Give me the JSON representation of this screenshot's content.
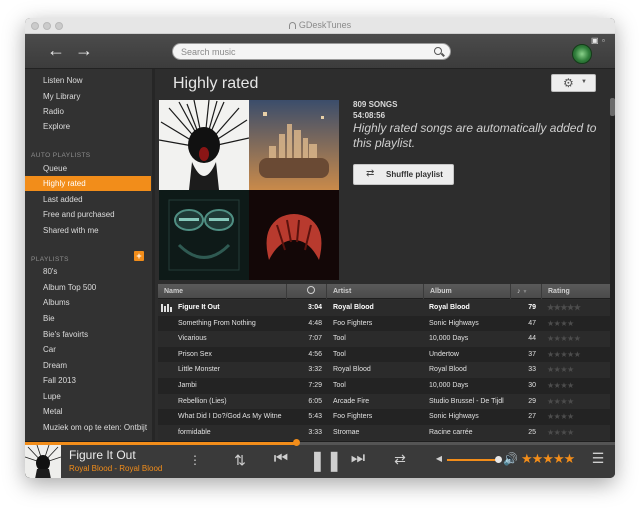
{
  "window": {
    "title": "GDeskTunes"
  },
  "search": {
    "placeholder": "Search music"
  },
  "sidebar": {
    "nav": [
      {
        "label": "Listen Now"
      },
      {
        "label": "My Library"
      },
      {
        "label": "Radio"
      },
      {
        "label": "Explore"
      }
    ],
    "auto_heading": "AUTO PLAYLISTS",
    "auto": [
      {
        "label": "Queue"
      },
      {
        "label": "Highly rated"
      },
      {
        "label": "Last added"
      },
      {
        "label": "Free and purchased"
      },
      {
        "label": "Shared with me"
      }
    ],
    "playlists_heading": "PLAYLISTS",
    "add_label": "+",
    "playlists": [
      {
        "label": "80's"
      },
      {
        "label": "Album Top 500"
      },
      {
        "label": "Albums"
      },
      {
        "label": "Bie"
      },
      {
        "label": "Bie's favoirts"
      },
      {
        "label": "Car"
      },
      {
        "label": "Dream"
      },
      {
        "label": "Fall 2013"
      },
      {
        "label": "Lupe"
      },
      {
        "label": "Metal"
      },
      {
        "label": "Muziek om op te eten: Ontbijt"
      }
    ]
  },
  "main": {
    "title": "Highly rated",
    "song_count": "809 SONGS",
    "duration": "54:08:56",
    "description": "Highly rated songs are automatically added to this playlist.",
    "shuffle_label": "Shuffle playlist",
    "columns": {
      "name": "Name",
      "artist": "Artist",
      "album": "Album",
      "rating": "Rating"
    },
    "rows": [
      {
        "name": "Figure It Out",
        "time": "3:04",
        "artist": "Royal Blood",
        "album": "Royal Blood",
        "plays": "79",
        "stars": "★★★★★"
      },
      {
        "name": "Something From Nothing",
        "time": "4:48",
        "artist": "Foo Fighters",
        "album": "Sonic Highways",
        "plays": "47",
        "stars": "★★★★"
      },
      {
        "name": "Vicarious",
        "time": "7:07",
        "artist": "Tool",
        "album": "10,000 Days",
        "plays": "44",
        "stars": "★★★★★"
      },
      {
        "name": "Prison Sex",
        "time": "4:56",
        "artist": "Tool",
        "album": "Undertow",
        "plays": "37",
        "stars": "★★★★★"
      },
      {
        "name": "Little Monster",
        "time": "3:32",
        "artist": "Royal Blood",
        "album": "Royal Blood",
        "plays": "33",
        "stars": "★★★★"
      },
      {
        "name": "Jambi",
        "time": "7:29",
        "artist": "Tool",
        "album": "10,000 Days",
        "plays": "30",
        "stars": "★★★★"
      },
      {
        "name": "Rebellion (Lies)",
        "time": "6:05",
        "artist": "Arcade Fire",
        "album": "Studio Brussel - De Tijdl",
        "plays": "29",
        "stars": "★★★★"
      },
      {
        "name": "What Did I Do?/God As My Witne",
        "time": "5:43",
        "artist": "Foo Fighters",
        "album": "Sonic Highways",
        "plays": "27",
        "stars": "★★★★"
      },
      {
        "name": "formidable",
        "time": "3:33",
        "artist": "Stromae",
        "album": "Racine carrée",
        "plays": "25",
        "stars": "★★★★"
      }
    ]
  },
  "player": {
    "title": "Figure It Out",
    "artist_album": "Royal Blood - Royal Blood",
    "progress": 0.46,
    "volume": 0.9,
    "rating_stars": "★★★★★"
  },
  "colors": {
    "accent": "#f28d1a",
    "sidebar": "#323232",
    "content": "#2d2d2d"
  }
}
